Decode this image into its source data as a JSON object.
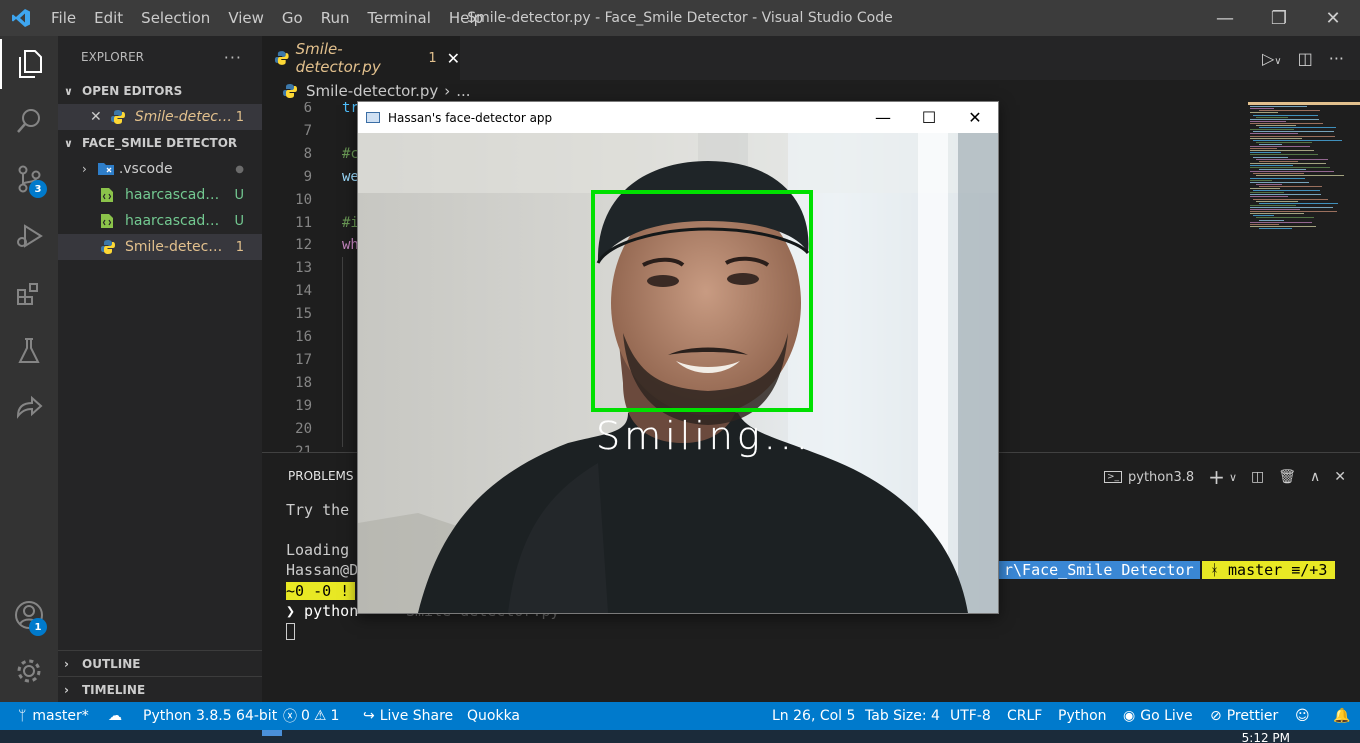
{
  "window": {
    "title": "Smile-detector.py - Face_Smile Detector - Visual Studio Code",
    "menu": [
      "File",
      "Edit",
      "Selection",
      "View",
      "Go",
      "Run",
      "Terminal",
      "Help"
    ]
  },
  "activity": {
    "source_control_badge": "3",
    "accounts_badge": "1"
  },
  "explorer": {
    "header": "EXPLORER",
    "open_editors_label": "OPEN EDITORS",
    "open_editor": {
      "name": "Smile-detector.py",
      "problems": "1"
    },
    "folder_label": "FACE_SMILE DETECTOR",
    "items": [
      {
        "name": ".vscode",
        "status": "●",
        "kind": "folder"
      },
      {
        "name": "haarcascade_frontalface_default.xml",
        "status": "U",
        "kind": "xml"
      },
      {
        "name": "haarcascade_smile.xml",
        "status": "U",
        "kind": "xml"
      },
      {
        "name": "Smile-detector.py",
        "status": "1",
        "kind": "py"
      }
    ],
    "outline_label": "OUTLINE",
    "timeline_label": "TIMELINE"
  },
  "editor": {
    "tab_label": "Smile-detector.py",
    "tab_problems": "1",
    "breadcrumb_file": "Smile-detector.py",
    "breadcrumb_rest": "...",
    "line_numbers": [
      "6",
      "7",
      "8",
      "9",
      "10",
      "11",
      "12",
      "13",
      "14",
      "15",
      "16",
      "17",
      "18",
      "19",
      "20",
      "21"
    ],
    "visible_code": [
      {
        "line": "6",
        "text": "tr",
        "color": "#4fc1ff"
      },
      {
        "line": "8",
        "text": "#c",
        "color": "#6a9955"
      },
      {
        "line": "9",
        "text": "we",
        "color": "#9cdcfe"
      },
      {
        "line": "11",
        "text": "#i",
        "color": "#6a9955"
      },
      {
        "line": "12",
        "text": "wh",
        "color": "#c586c0"
      }
    ]
  },
  "panel": {
    "tab": "PROBLEMS",
    "terminal_name": "python3.8",
    "lines": {
      "try": "Try the",
      "loading": "Loading",
      "prompt_user": "Hassan@D",
      "prompt_path": "r\\Face_Smile Detector",
      "prompt_branch": "ᚼ master ≡/+3",
      "status_segment": "~0 -0 !",
      "command": "❯ python",
      "command_ghost": "Smile-detector.py"
    }
  },
  "cv_window": {
    "title": "Hassan's face-detector app",
    "overlay_text": "Smiling...",
    "box_color": "#00e000"
  },
  "statusbar": {
    "branch": "master*",
    "python": "Python 3.8.5 64-bit",
    "errors": "0",
    "warnings": "1",
    "live_share": "Live Share",
    "quokka": "Quokka",
    "position": "Ln 26, Col 5",
    "tab_size": "Tab Size: 4",
    "encoding": "UTF-8",
    "eol": "CRLF",
    "language": "Python",
    "go_live": "Go Live",
    "prettier": "Prettier"
  },
  "taskbar": {
    "time": "5:12 PM"
  },
  "colors": {
    "accent": "#007acc",
    "modified": "#e2c08d",
    "untracked": "#73c991"
  }
}
